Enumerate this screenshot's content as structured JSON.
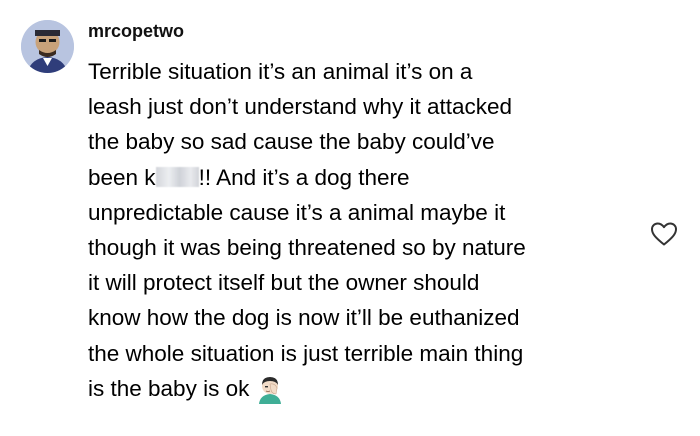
{
  "comment": {
    "username": "mrcopetwo",
    "lines": [
      "Terrible situation it’s an animal it’s on a",
      "leash just don’t understand why it attacked",
      "the baby so sad cause the baby could’ve",
      "been k",
      "!! And it’s a dog there",
      "unpredictable cause it’s a animal maybe it",
      "though it was being threatened so by nature",
      "it will protect itself but the owner should",
      "know how the dog is now it’ll be euthanized",
      "the whole situation is just terrible main thing",
      "is the baby is ok"
    ],
    "redaction_icon": "blurred-text",
    "emoji_icon": "face-palm-emoji-icon"
  },
  "actions": {
    "like_icon": "heart-outline-icon"
  },
  "colors": {
    "background": "#ffffff",
    "text": "#000000",
    "heart_stroke": "#333333"
  }
}
